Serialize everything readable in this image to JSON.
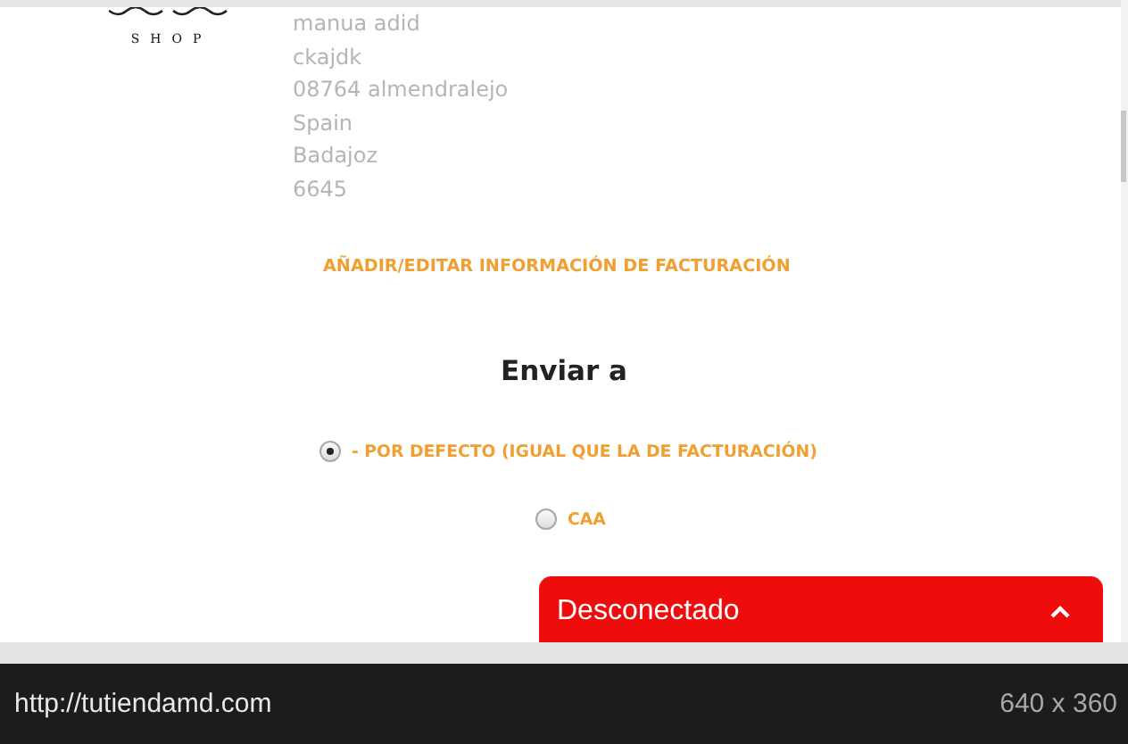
{
  "logo": {
    "text": "SHOP"
  },
  "billing_address": {
    "lines": [
      "manua adid",
      "ckajdk",
      "08764 almendralejo",
      "Spain",
      "Badajoz",
      "6645"
    ]
  },
  "edit_billing_link": "AÑADIR/EDITAR INFORMACIÓN DE FACTURACIÓN",
  "ship_to": {
    "title": "Enviar a",
    "options": [
      {
        "label": "- POR DEFECTO (IGUAL QUE LA DE FACTURACIÓN)",
        "selected": true
      },
      {
        "label": "CAA",
        "selected": false
      }
    ]
  },
  "chat_widget": {
    "status": "Desconectado"
  },
  "status_bar": {
    "url": "http://tutiendamd.com",
    "size": "640 x 360"
  }
}
